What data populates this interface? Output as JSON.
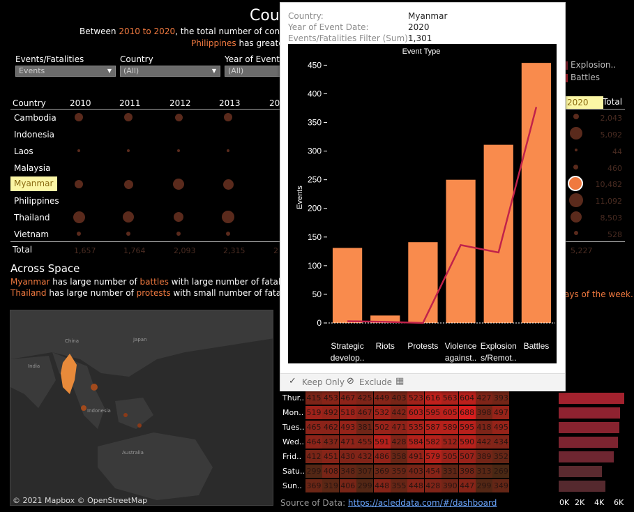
{
  "title": "Cou",
  "subtitle": {
    "pre": "Between ",
    "range": "2010 to 2020",
    "post": ", the total number of conflicts ros",
    "line2_country": "Philippines",
    "line2_post": " has greatest"
  },
  "filters": {
    "events_label": "Events/Fatalities",
    "events_value": "Events",
    "country_label": "Country",
    "country_value": "(All)",
    "year_label": "Year of Event Da",
    "year_value": "(All)"
  },
  "legend_right": [
    "Explosion..",
    "Battles"
  ],
  "table": {
    "col_header_country": "Country",
    "years": [
      "2010",
      "2011",
      "2012",
      "2013",
      "201"
    ],
    "right_year": "2020",
    "right_total_header": "Total",
    "countries": [
      "Cambodia",
      "Indonesia",
      "Laos",
      "Malaysia",
      "Myanmar",
      "Philippines",
      "Thailand",
      "Vietnam"
    ],
    "row_totals": [
      "2,043",
      "5,092",
      "44",
      "460",
      "10,482",
      "11,092",
      "8,503",
      "528"
    ],
    "total_label": "Total",
    "column_totals": [
      "1,657",
      "1,764",
      "2,093",
      "2,315",
      "2"
    ],
    "right_column_total": "5,227",
    "selected_country": "Myanmar"
  },
  "across_space": {
    "heading": "Across Space",
    "line1": [
      "Myanmar",
      " has large number of ",
      "battles",
      " with large number of fatalities."
    ],
    "line2": [
      "Thailand",
      " has large number of ",
      "protests",
      " with small number of fatalities"
    ]
  },
  "right_note": "ays of the week.",
  "map": {
    "attribution": "© 2021 Mapbox  © OpenStreetMap",
    "labels": [
      "China",
      "Japan",
      "India",
      "Indonesia",
      "Australia"
    ]
  },
  "tooltip": {
    "rows": [
      {
        "label": "Country:",
        "value": "Myanmar"
      },
      {
        "label": "Year of Event Date:",
        "value": "2020"
      },
      {
        "label": "Events/Fatalities Filter (Sum):",
        "value": "1,301"
      }
    ],
    "actions": {
      "keep_only": "Keep Only",
      "exclude": "Exclude"
    }
  },
  "chart_data": {
    "type": "bar",
    "title": "Event Type",
    "ylabel": "Events",
    "categories": [
      "Strategic develop..",
      "Riots",
      "Protests",
      "Violence against..",
      "Explosion s/Remot..",
      "Battles"
    ],
    "category_lines": [
      [
        "Strategic",
        "develop.."
      ],
      [
        "Riots"
      ],
      [
        "Protests"
      ],
      [
        "Violence",
        "against.."
      ],
      [
        "Explosion",
        "s/Remot.."
      ],
      [
        "Battles"
      ]
    ],
    "series": [
      {
        "values": [
          131,
          13,
          141,
          250,
          311,
          454
        ],
        "color": "#f98b4d"
      },
      {
        "values": [
          3,
          2,
          0,
          136,
          123,
          377
        ],
        "color": "#c0224a"
      }
    ],
    "yticks": [
      0,
      50,
      100,
      150,
      200,
      250,
      300,
      350,
      400,
      450
    ],
    "ylim": [
      0,
      470
    ]
  },
  "heatmap": {
    "days": [
      "Thur..",
      "Mon..",
      "Tues..",
      "Wed..",
      "Frid..",
      "Satu..",
      "Sun.."
    ],
    "values": [
      [
        415,
        453,
        467,
        425,
        449,
        403,
        523,
        616,
        563,
        604,
        427,
        393
      ],
      [
        519,
        492,
        518,
        467,
        532,
        442,
        603,
        595,
        605,
        688,
        398,
        497
      ],
      [
        465,
        462,
        493,
        381,
        502,
        471,
        535,
        587,
        589,
        595,
        418,
        495
      ],
      [
        464,
        437,
        471,
        455,
        591,
        428,
        584,
        582,
        512,
        590,
        442,
        434
      ],
      [
        412,
        451,
        430,
        432,
        486,
        358,
        491,
        579,
        505,
        507,
        389,
        352
      ],
      [
        299,
        408,
        348,
        307,
        369,
        359,
        403,
        454,
        331,
        398,
        313,
        269
      ],
      [
        369,
        319,
        406,
        299,
        448,
        355,
        448,
        428,
        390,
        447,
        299,
        349
      ]
    ],
    "bar_axis": [
      "0K",
      "2K",
      "4K",
      "6K"
    ],
    "bar_fraction": [
      0.99,
      0.93,
      0.92,
      0.89,
      0.83,
      0.65,
      0.7
    ]
  },
  "source": {
    "label": "Source of Data: ",
    "link": "https://acleddata.com/#/dashboard"
  }
}
